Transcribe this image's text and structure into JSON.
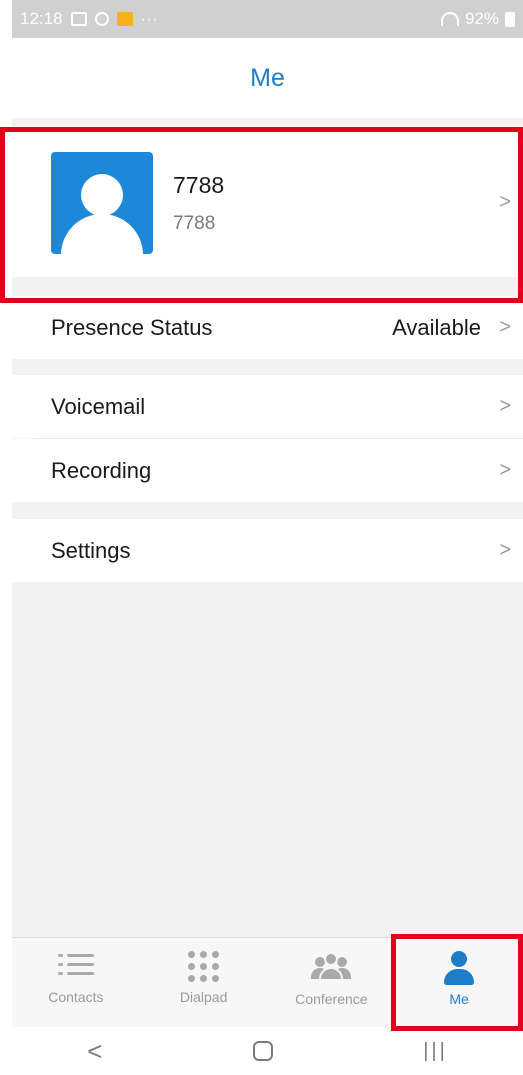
{
  "status_bar": {
    "time": "12:18",
    "dots": "···",
    "battery": "92%"
  },
  "header": {
    "title": "Me"
  },
  "profile": {
    "name": "7788",
    "number": "7788",
    "avatar_icon": "user-avatar-icon"
  },
  "menu": {
    "presence_label": "Presence Status",
    "presence_value": "Available",
    "voicemail_label": "Voicemail",
    "recording_label": "Recording",
    "settings_label": "Settings",
    "chevron": ">"
  },
  "bottom_nav": {
    "items": [
      {
        "label": "Contacts",
        "icon": "list-icon"
      },
      {
        "label": "Dialpad",
        "icon": "dialpad-icon"
      },
      {
        "label": "Conference",
        "icon": "group-icon"
      },
      {
        "label": "Me",
        "icon": "person-icon",
        "active": true
      }
    ]
  },
  "system_nav": {
    "back": "<",
    "recent": "|||"
  },
  "colors": {
    "accent": "#1e7cc8",
    "highlight": "#e3001b",
    "background": "#f2f2f2"
  }
}
